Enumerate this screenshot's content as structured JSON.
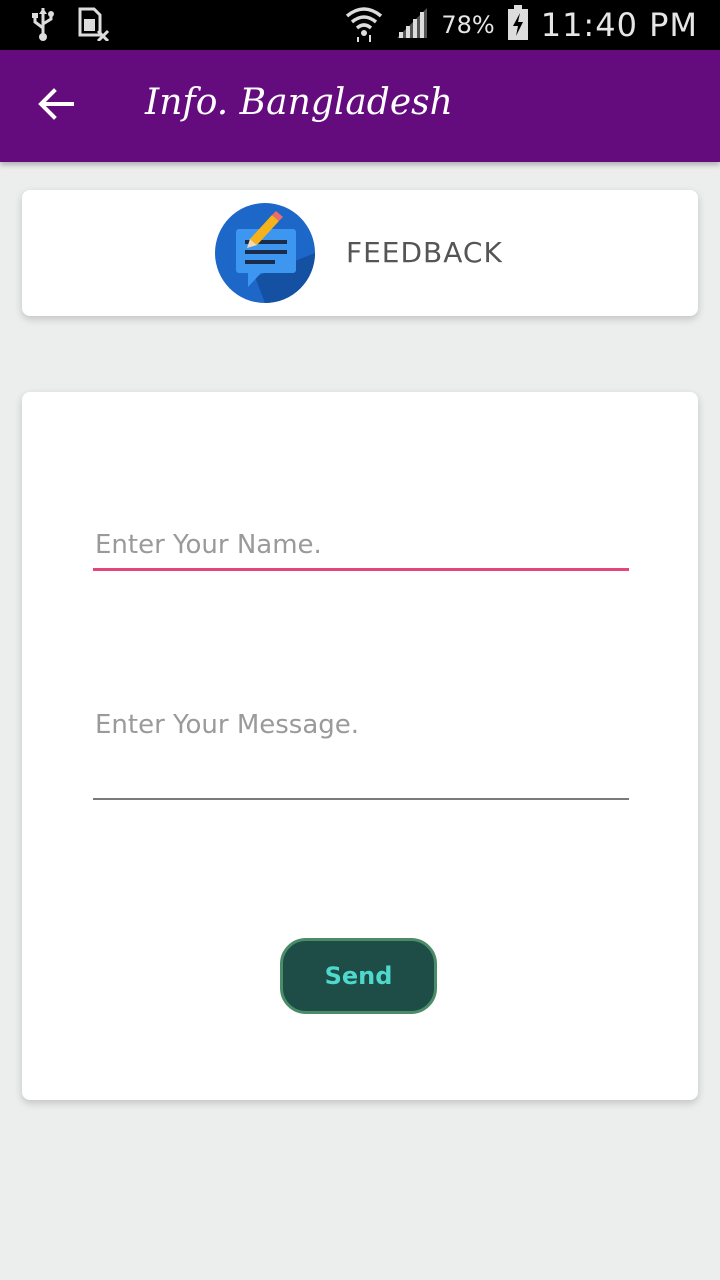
{
  "status_bar": {
    "battery": "78%",
    "time": "11:40 PM",
    "icons": [
      "usb-icon",
      "sim-card-icon",
      "wifi-icon",
      "signal-icon",
      "battery-icon"
    ]
  },
  "app_bar": {
    "title": "Info. Bangladesh",
    "background": "#640c7e"
  },
  "header_card": {
    "label": "FEEDBACK",
    "icon": "feedback-icon"
  },
  "form": {
    "name_placeholder": "Enter Your Name.",
    "message_placeholder": "Enter Your Message.",
    "send_label": "Send",
    "accent": "#e5457c",
    "button_color": "#1e4c47"
  }
}
